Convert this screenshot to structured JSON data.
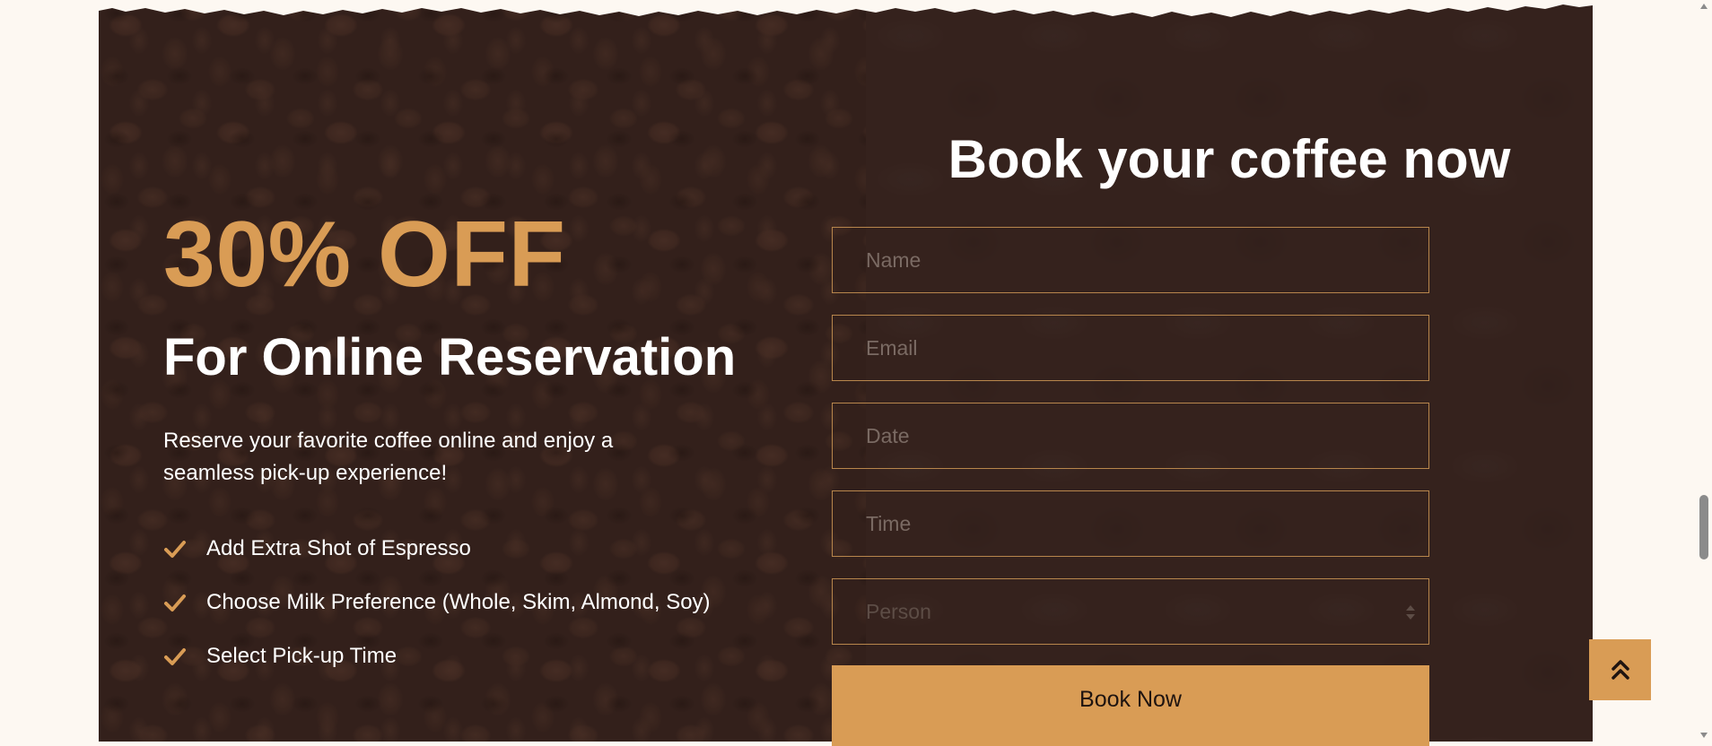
{
  "promo": {
    "discount": "30% OFF",
    "subheading": "For Online Reservation",
    "description": "Reserve your favorite coffee online and enjoy a seamless pick-up experience!",
    "features": [
      "Add Extra Shot of Espresso",
      "Choose Milk Preference (Whole, Skim, Almond, Soy)",
      "Select Pick-up Time"
    ]
  },
  "booking": {
    "title": "Book your coffee now",
    "name_placeholder": "Name",
    "email_placeholder": "Email",
    "date_placeholder": "Date",
    "time_placeholder": "Time",
    "person_placeholder": "Person",
    "submit_label": "Book Now"
  },
  "icons": {
    "feature_icon": "check-icon",
    "back_to_top_icon": "double-chevron-up-icon",
    "select_icon": "sort-arrows-icon"
  },
  "colors": {
    "accent": "#d99c55",
    "section_bg": "#33221d",
    "page_bg": "#fdf8f2",
    "text": "#ffffff"
  }
}
